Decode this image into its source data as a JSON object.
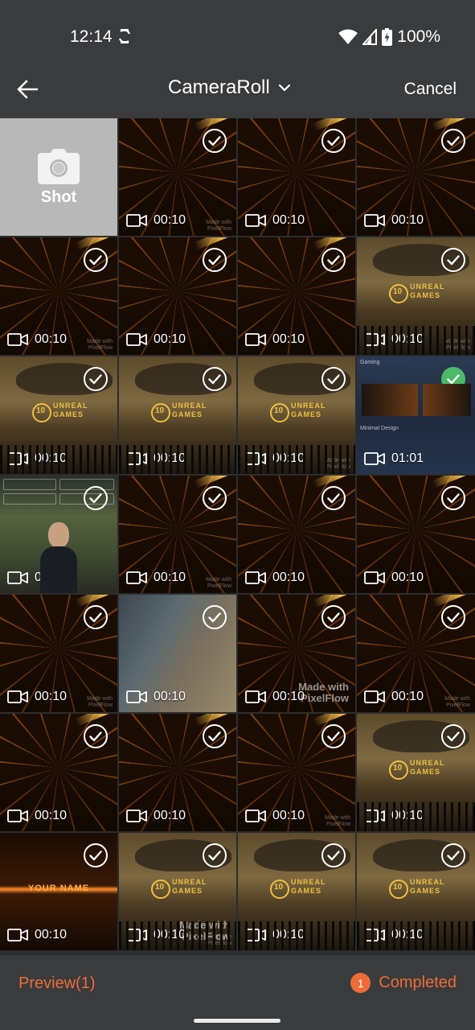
{
  "status_bar": {
    "time": "12:14",
    "battery": "100%"
  },
  "header": {
    "title": "CameraRoll",
    "cancel_label": "Cancel"
  },
  "grid": {
    "shot_label": "Shot",
    "tiles": [
      {
        "duration": "00:10",
        "visual": "tunnel",
        "selected": false
      },
      {
        "duration": "00:10",
        "visual": "tunnel",
        "selected": false
      },
      {
        "duration": "00:10",
        "visual": "tunnel",
        "selected": false
      },
      {
        "duration": "00:10",
        "visual": "tunnel",
        "selected": false
      },
      {
        "duration": "00:10",
        "visual": "tunnel",
        "selected": false
      },
      {
        "duration": "00:10",
        "visual": "tunnel",
        "selected": false
      },
      {
        "duration": "00:10",
        "visual": "castle",
        "selected": false
      },
      {
        "duration": "00:10",
        "visual": "castle",
        "selected": false
      },
      {
        "duration": "00:10",
        "visual": "castle",
        "selected": false
      },
      {
        "duration": "00:10",
        "visual": "castle",
        "selected": false
      },
      {
        "duration": "01:01",
        "visual": "ui",
        "selected": true
      },
      {
        "duration": "00:14",
        "visual": "person",
        "selected": false
      },
      {
        "duration": "00:10",
        "visual": "tunnel",
        "selected": false
      },
      {
        "duration": "00:10",
        "visual": "tunnel",
        "selected": false
      },
      {
        "duration": "00:10",
        "visual": "tunnel",
        "selected": false
      },
      {
        "duration": "00:10",
        "visual": "tunnel",
        "selected": false
      },
      {
        "duration": "00:10",
        "visual": "beach",
        "selected": false
      },
      {
        "duration": "00:10",
        "visual": "tunnel",
        "selected": false
      },
      {
        "duration": "00:10",
        "visual": "tunnel",
        "selected": false
      },
      {
        "duration": "00:10",
        "visual": "tunnel",
        "selected": false
      },
      {
        "duration": "00:10",
        "visual": "tunnel",
        "selected": false
      },
      {
        "duration": "00:10",
        "visual": "tunnel",
        "selected": false
      },
      {
        "duration": "00:10",
        "visual": "castle",
        "selected": false
      },
      {
        "duration": "00:10",
        "visual": "neon",
        "selected": false
      },
      {
        "duration": "00:10",
        "visual": "castle",
        "selected": false
      },
      {
        "duration": "00:10",
        "visual": "castle",
        "selected": false
      },
      {
        "duration": "00:10",
        "visual": "castle",
        "selected": false
      }
    ],
    "in_image_text": {
      "logo_number": "10",
      "logo_word": "UNREAL GAMES",
      "watermark": "Made with PixelFlow",
      "ui_section_1": "Gaming",
      "ui_section_2": "Minimal Design",
      "neon_caption": "YOUR NAME"
    }
  },
  "bottom_bar": {
    "preview_label": "Preview(1)",
    "completed_count": "1",
    "completed_label": "Completed"
  },
  "colors": {
    "accent": "#ee6b3a",
    "selected": "#4cb86a",
    "background": "#3a3b3d"
  }
}
